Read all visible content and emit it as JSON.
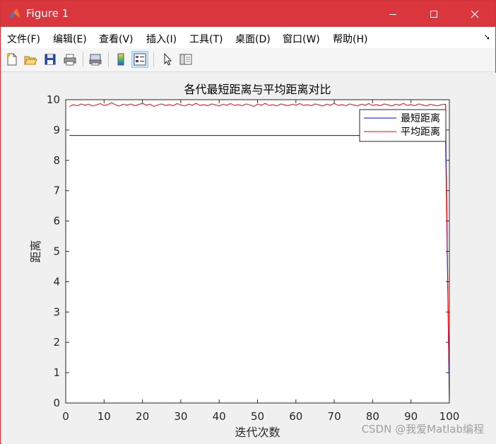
{
  "window": {
    "title": "Figure 1"
  },
  "menu": [
    "文件(F)",
    "编辑(E)",
    "查看(V)",
    "插入(I)",
    "工具(T)",
    "桌面(D)",
    "窗口(W)",
    "帮助(H)"
  ],
  "toolbar_icons": [
    "new-figure-icon",
    "open-file-icon",
    "save-icon",
    "print-icon",
    "print-preview-icon",
    "colorbar-icon",
    "legend-icon",
    "pointer-icon",
    "property-inspector-icon"
  ],
  "watermark": "CSDN @我爱Matlab编程",
  "colors": {
    "titlebar": "#d9363e",
    "series_min": "#0000ff",
    "series_avg": "#ff0000"
  },
  "chart_data": {
    "type": "line",
    "title": "各代最短距离与平均距离对比",
    "xlabel": "迭代次数",
    "ylabel": "距离",
    "xlim": [
      0,
      100
    ],
    "ylim": [
      0,
      10
    ],
    "xticks": [
      "0",
      "10",
      "20",
      "30",
      "40",
      "50",
      "60",
      "70",
      "80",
      "90",
      "100"
    ],
    "yticks": [
      "0",
      "1",
      "2",
      "3",
      "4",
      "5",
      "6",
      "7",
      "8",
      "9",
      "10"
    ],
    "grid": false,
    "legend": "top-right",
    "series": [
      {
        "name": "最短距离",
        "color": "#0000ff",
        "x": [
          1,
          99,
          100
        ],
        "values": [
          8.82,
          8.82,
          0
        ]
      },
      {
        "name": "平均距离",
        "color": "#ff0000",
        "x": [
          1,
          2,
          3,
          4,
          5,
          6,
          7,
          8,
          9,
          10,
          11,
          12,
          13,
          14,
          15,
          16,
          17,
          18,
          19,
          20,
          21,
          22,
          23,
          24,
          25,
          26,
          27,
          28,
          29,
          30,
          31,
          32,
          33,
          34,
          35,
          36,
          37,
          38,
          39,
          40,
          41,
          42,
          43,
          44,
          45,
          46,
          47,
          48,
          49,
          50,
          51,
          52,
          53,
          54,
          55,
          56,
          57,
          58,
          59,
          60,
          61,
          62,
          63,
          64,
          65,
          66,
          67,
          68,
          69,
          70,
          71,
          72,
          73,
          74,
          75,
          76,
          77,
          78,
          79,
          80,
          81,
          82,
          83,
          84,
          85,
          86,
          87,
          88,
          89,
          90,
          91,
          92,
          93,
          94,
          95,
          96,
          97,
          98,
          99,
          100
        ],
        "values": [
          9.78,
          9.84,
          9.8,
          9.86,
          9.82,
          9.85,
          9.79,
          9.83,
          9.87,
          9.81,
          9.84,
          9.9,
          9.83,
          9.79,
          9.85,
          9.82,
          9.86,
          9.8,
          9.84,
          9.88,
          9.82,
          9.85,
          9.78,
          9.83,
          9.86,
          9.81,
          9.84,
          9.8,
          9.87,
          9.83,
          9.79,
          9.85,
          9.82,
          9.88,
          9.81,
          9.84,
          9.8,
          9.86,
          9.83,
          9.79,
          9.85,
          9.82,
          9.87,
          9.81,
          9.84,
          9.8,
          9.86,
          9.83,
          9.78,
          9.85,
          9.82,
          9.88,
          9.81,
          9.84,
          9.79,
          9.86,
          9.83,
          9.8,
          9.85,
          9.82,
          9.87,
          9.81,
          9.84,
          9.8,
          9.86,
          9.83,
          9.79,
          9.85,
          9.82,
          9.88,
          9.81,
          9.84,
          9.8,
          9.86,
          9.83,
          9.79,
          9.85,
          9.82,
          9.87,
          9.81,
          9.84,
          9.8,
          9.86,
          9.83,
          9.79,
          9.85,
          9.82,
          9.88,
          9.81,
          9.84,
          9.8,
          9.86,
          9.83,
          9.79,
          9.85,
          9.82,
          9.8,
          9.84,
          9.85,
          0
        ]
      }
    ]
  }
}
